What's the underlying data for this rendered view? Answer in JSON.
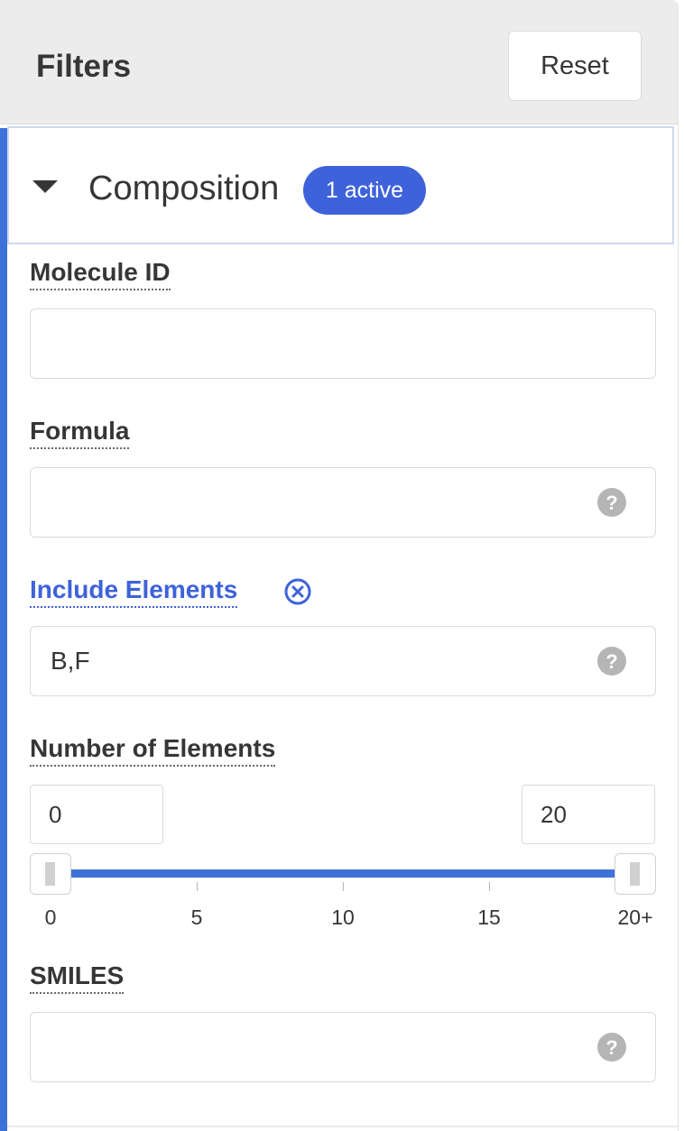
{
  "header": {
    "title": "Filters",
    "reset_label": "Reset"
  },
  "group": {
    "title": "Composition",
    "badge": "1 active",
    "expanded": true
  },
  "fields": {
    "molecule_id": {
      "label": "Molecule ID",
      "value": ""
    },
    "formula": {
      "label": "Formula",
      "value": "",
      "help_icon": "question-circle-icon"
    },
    "include_elements": {
      "label": "Include Elements",
      "value": "B,F",
      "help_icon": "question-circle-icon",
      "clear_icon": "times-circle-icon",
      "active": true
    },
    "number_of_elements": {
      "label": "Number of Elements",
      "min_value": "0",
      "max_value": "20",
      "range": [
        0,
        20
      ],
      "scale_min": 0,
      "scale_max": 20,
      "ticks": [
        "0",
        "5",
        "10",
        "15",
        "20+"
      ]
    },
    "smiles": {
      "label": "SMILES",
      "value": "",
      "help_icon": "question-circle-icon"
    }
  },
  "colors": {
    "accent": "#3e62d9",
    "accent_bar": "#3e72d9",
    "header_bg": "#ececec",
    "text": "#363636",
    "border": "#dbdbdb",
    "icon_gray": "#b5b5b5"
  }
}
